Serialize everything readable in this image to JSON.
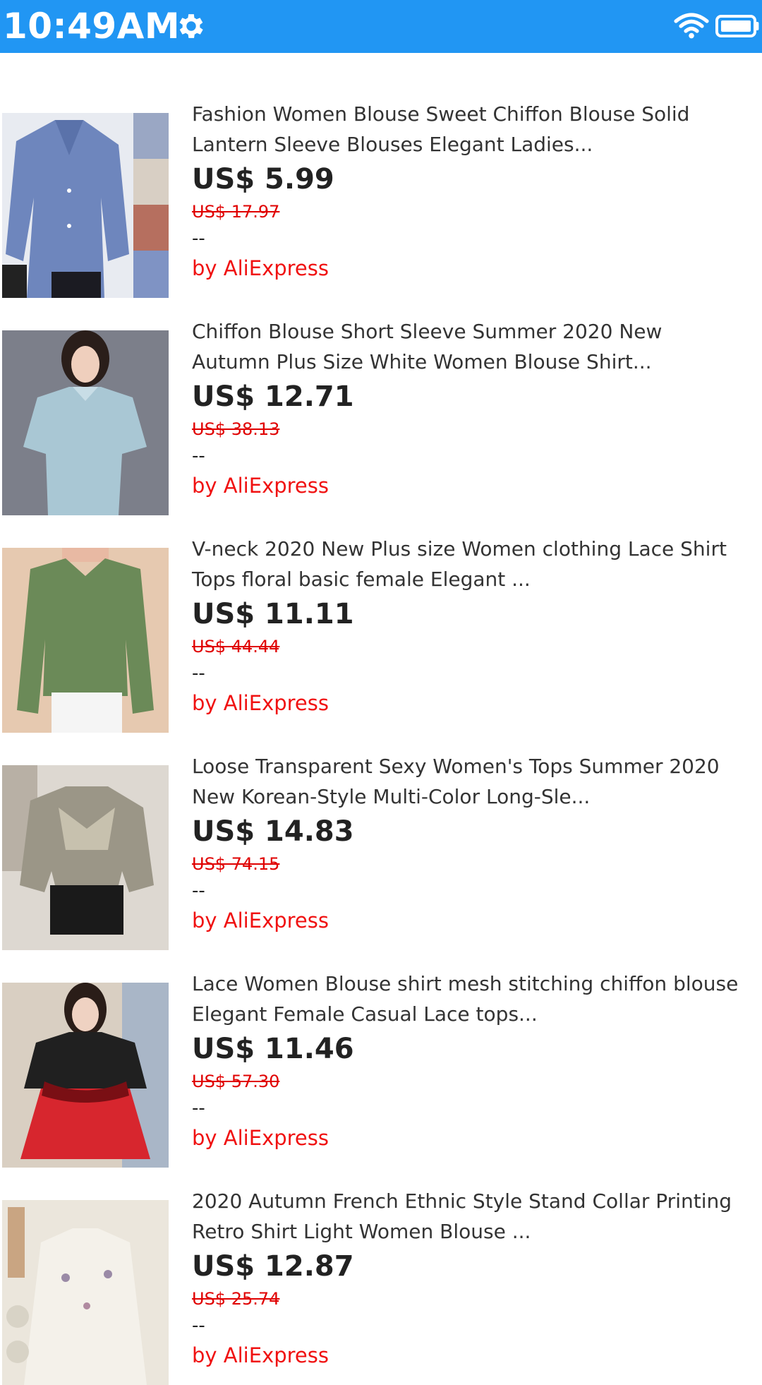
{
  "status_bar": {
    "time": "10:49AM",
    "icons": [
      "gear-icon",
      "wifi-icon",
      "battery-icon"
    ],
    "background": "#2196F3"
  },
  "products": [
    {
      "title_line1": "Fashion Women Blouse Sweet Chiffon Blouse Solid",
      "title_line2": "Lantern Sleeve Blouses Elegant Ladies...",
      "price": "US$ 5.99",
      "old_price": "US$ 17.97",
      "extra": "--",
      "seller": "by AliExpress"
    },
    {
      "title_line1": "Chiffon Blouse Short Sleeve Summer 2020 New",
      "title_line2": "Autumn Plus Size White Women Blouse Shirt...",
      "price": "US$ 12.71",
      "old_price": "US$ 38.13",
      "extra": "--",
      "seller": "by AliExpress"
    },
    {
      "title_line1": "V-neck 2020 New Plus size Women clothing Lace Shirt",
      "title_line2": "Tops floral basic female Elegant ...",
      "price": "US$ 11.11",
      "old_price": "US$ 44.44",
      "extra": "--",
      "seller": "by AliExpress"
    },
    {
      "title_line1": "Loose Transparent Sexy Women's Tops Summer 2020",
      "title_line2": "New Korean-Style Multi-Color Long-Sle...",
      "price": "US$ 14.83",
      "old_price": "US$ 74.15",
      "extra": "--",
      "seller": "by AliExpress"
    },
    {
      "title_line1": "Lace Women Blouse shirt mesh stitching chiffon blouse",
      "title_line2": "Elegant Female Casual Lace tops...",
      "price": "US$ 11.46",
      "old_price": "US$ 57.30",
      "extra": "--",
      "seller": "by AliExpress"
    },
    {
      "title_line1": "2020 Autumn French Ethnic Style Stand Collar Printing",
      "title_line2": "Retro Shirt Light Women Blouse ...",
      "price": "US$ 12.87",
      "old_price": "US$ 25.74",
      "extra": "--",
      "seller": "by AliExpress"
    }
  ],
  "colors": {
    "accent": "#2196F3",
    "sale_red": "#E00000",
    "text": "#222222"
  }
}
